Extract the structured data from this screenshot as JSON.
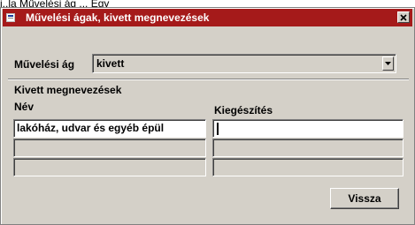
{
  "background": {
    "text": "i..la Művelési ág ... Egy"
  },
  "window": {
    "title": "Művelési ágak, kivett megnevezések",
    "title_bar_color": "#a51a1a",
    "body_color": "#d4d0c8"
  },
  "form": {
    "muvelesi_ag_label": "Művelési ág",
    "muvelesi_ag_value": "kivett",
    "section_title": "Kivett megnevezések",
    "columns": {
      "nev": "Név",
      "kiegeszites": "Kiegészítés"
    },
    "rows": [
      {
        "nev": "lakóház, udvar és egyéb épül",
        "kiegeszites": ""
      },
      {
        "nev": "",
        "kiegeszites": ""
      },
      {
        "nev": "",
        "kiegeszites": ""
      }
    ]
  },
  "buttons": {
    "vissza": "Vissza"
  },
  "icons": {
    "window": "app-icon",
    "close": "close-icon",
    "dropdown": "chevron-down-icon"
  }
}
